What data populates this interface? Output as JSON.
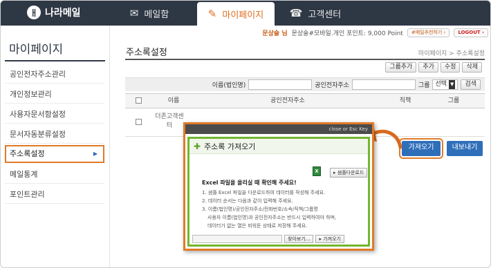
{
  "brand": {
    "name": "나라메일",
    "logo_mark": "ㅐ"
  },
  "nav": {
    "tabs": [
      {
        "label": "메일함",
        "icon": "envelope-icon",
        "glyph": "✉"
      },
      {
        "label": "마이페이지",
        "icon": "pencil-icon",
        "glyph": "✎"
      },
      {
        "label": "고객센터",
        "icon": "phone-icon",
        "glyph": "☎"
      }
    ]
  },
  "userbar": {
    "name": "문상술 님",
    "info": "문상술#모바일.개인 포인트: 9,000 Point",
    "recommend_button": "#메일추천하기 ›",
    "logout_button": "LOGOUT ›"
  },
  "sidebar": {
    "title": "마이페이지",
    "items": [
      {
        "label": "공인전자주소관리"
      },
      {
        "label": "개인정보관리"
      },
      {
        "label": "사용자문서함설정"
      },
      {
        "label": "문서자동분류설정"
      },
      {
        "label": "주소록설정",
        "arrow": "▶"
      },
      {
        "label": "메일통계"
      },
      {
        "label": "포인트관리"
      }
    ]
  },
  "main": {
    "title": "주소록설정",
    "breadcrumb": "마이페이지 > 주소록설정",
    "buttons": [
      "그룹추가",
      "추가",
      "수정",
      "삭제"
    ],
    "search": {
      "name_label": "이름(법인명)",
      "address_label": "공인전자주소",
      "group_label": "그룹",
      "group_select": "선택",
      "search_button": "검색"
    },
    "table": {
      "headers": [
        "이름",
        "공인전자주소",
        "직책",
        "그룹"
      ],
      "rows": [
        {
          "name": "더존고객센터",
          "address": ""
        }
      ]
    },
    "import_button": "가져오기",
    "export_button": "내보내기"
  },
  "modal": {
    "close_text": "close or Esc Key",
    "title": "주소록 가져오기",
    "sample_button": "샘플다운로드",
    "instruction_title": "Excel 파일을 올리실 때 확인해 주세요!",
    "instructions": [
      "1. 샘플 Excel 파일을 다운로드하여 데이터를 작성해 주세요.",
      "2. 데이터 순서는 다음과 같이 입력해 주세요.",
      "3. 이름(법인명)/공인전자주소/전화번호/소속/직책/그룹명",
      "사용자 이름(법인명)과 공인전자주소는 반드시 입력하여야 하며,",
      "데이터가 없는 열은 비워둔 상태로 저장해 주세요."
    ],
    "browse_button": "찾아보기...",
    "import_button": "가져오기"
  },
  "colors": {
    "nav_bg": "#2e3744",
    "accent_orange": "#e07a28",
    "primary_blue": "#2f6fb9",
    "modal_green": "#72b62e"
  }
}
